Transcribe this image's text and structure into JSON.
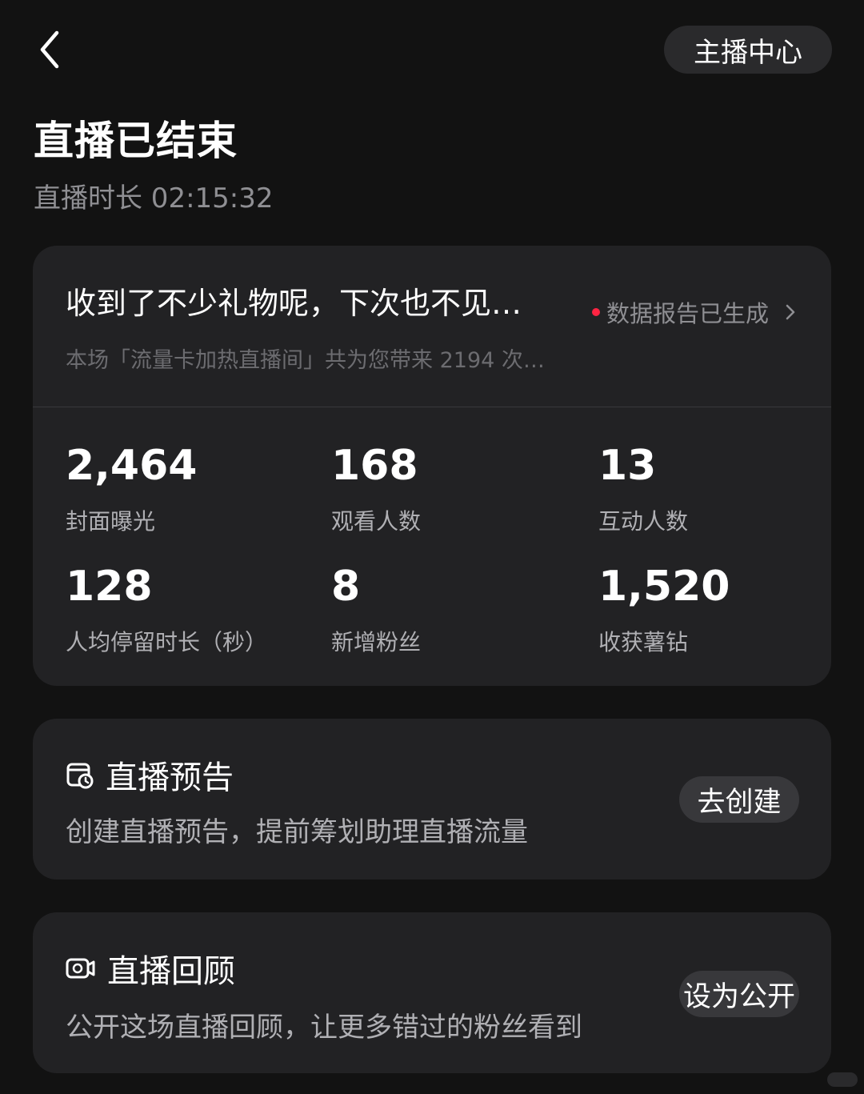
{
  "header": {
    "back_icon": "chevron-left-icon",
    "anchor_center_label": "主播中心"
  },
  "summary": {
    "title": "直播已结束",
    "duration": "直播时长 02:15:32"
  },
  "report": {
    "headline": "收到了不少礼物呢，下次也不见…",
    "link_label": "数据报告已生成",
    "link_dot_color": "#ff2442",
    "subtitle": "本场「流量卡加热直播间」共为您带来 2194 次…"
  },
  "stats": [
    {
      "value": "2,464",
      "label": "封面曝光"
    },
    {
      "value": "168",
      "label": "观看人数"
    },
    {
      "value": "13",
      "label": "互动人数"
    },
    {
      "value": "128",
      "label": "人均停留时长（秒）"
    },
    {
      "value": "8",
      "label": "新增粉丝"
    },
    {
      "value": "1,520",
      "label": "收获薯钻"
    }
  ],
  "preview_card": {
    "icon": "calendar-clock-icon",
    "title": "直播预告",
    "description": "创建直播预告，提前筹划助理直播流量",
    "button_label": "去创建"
  },
  "replay_card": {
    "icon": "video-replay-icon",
    "title": "直播回顾",
    "description": "公开这场直播回顾，让更多错过的粉丝看到",
    "button_label": "设为公开"
  },
  "colors": {
    "background": "#121212",
    "card": "#222224",
    "accent_red": "#ff2442"
  }
}
